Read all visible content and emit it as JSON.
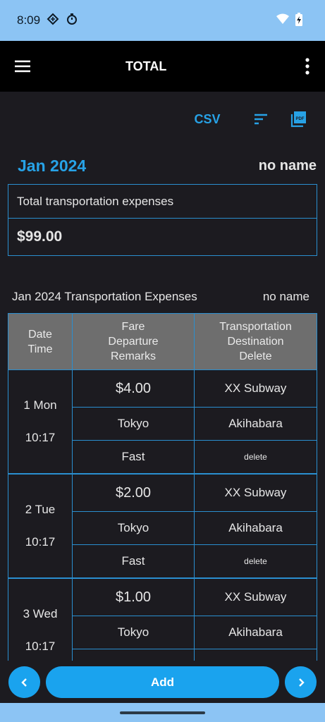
{
  "status": {
    "time": "8:09"
  },
  "appbar": {
    "title": "TOTAL"
  },
  "toolbar": {
    "csv_label": "CSV"
  },
  "header": {
    "month": "Jan 2024",
    "name": "no name"
  },
  "summary": {
    "label": "Total transportation expenses",
    "value": "$99.00"
  },
  "section": {
    "title": "Jan 2024 Transportation Expenses",
    "name": "no name"
  },
  "table": {
    "headers": [
      "Date\nTime",
      "Fare\nDeparture\nRemarks",
      "Transportation\nDestination\nDelete"
    ],
    "rows": [
      {
        "date": "1 Mon",
        "time": "10:17",
        "fare": "$4.00",
        "transport": "XX Subway",
        "departure": "Tokyo",
        "destination": "Akihabara",
        "remarks": "Fast",
        "delete": "delete"
      },
      {
        "date": "2 Tue",
        "time": "10:17",
        "fare": "$2.00",
        "transport": "XX Subway",
        "departure": "Tokyo",
        "destination": "Akihabara",
        "remarks": "Fast",
        "delete": "delete"
      },
      {
        "date": "3 Wed",
        "time": "10:17",
        "fare": "$1.00",
        "transport": "XX Subway",
        "departure": "Tokyo",
        "destination": "Akihabara",
        "remarks": "",
        "delete": ""
      }
    ]
  },
  "bottom": {
    "add_label": "Add"
  },
  "colors": {
    "accent": "#27a2e6",
    "button": "#1aa3ee",
    "background": "#1c1b20",
    "status_bar": "#8cc4f4"
  }
}
